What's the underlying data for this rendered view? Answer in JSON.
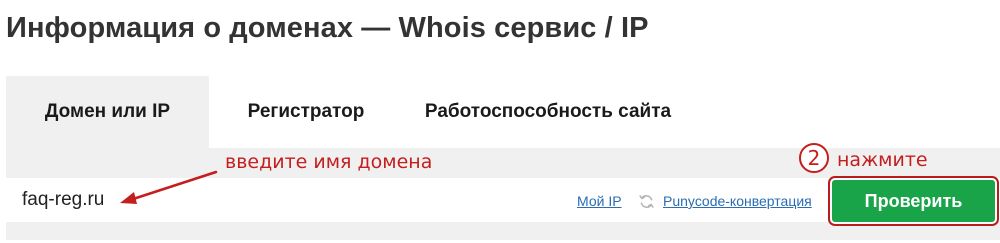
{
  "page": {
    "title": "Информация о доменах — Whois сервис / IP"
  },
  "tabs": [
    {
      "label": "Домен или IP",
      "active": true
    },
    {
      "label": "Регистратор",
      "active": false
    },
    {
      "label": "Работоспособность сайта",
      "active": false
    }
  ],
  "search": {
    "value": "faq-reg.ru",
    "my_ip_label": "Мой IP",
    "punycode_label": "Punycode-конвертация",
    "refresh_icon": "refresh-icon",
    "submit_label": "Проверить"
  },
  "annotations": {
    "enter_domain": "введите имя домена",
    "step_number": "2",
    "press": "нажмите"
  },
  "colors": {
    "button_green": "#1aa44a",
    "annotation_red": "#c41e1e",
    "link_blue": "#2a6db3",
    "panel_gray": "#f0f0f0"
  }
}
